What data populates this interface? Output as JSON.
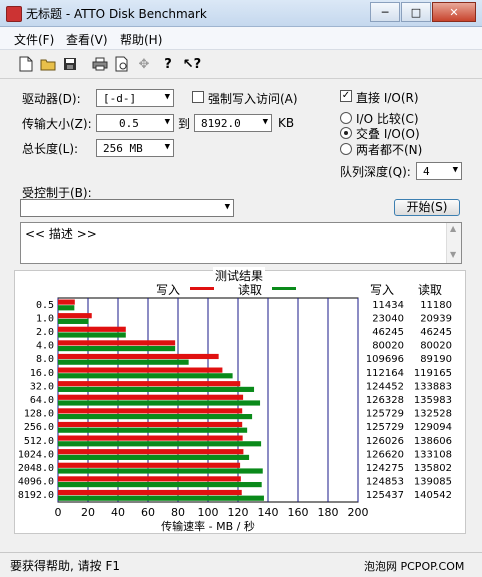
{
  "window": {
    "title": "无标题 - ATTO Disk Benchmark"
  },
  "menu": [
    "文件(F)",
    "查看(V)",
    "帮助(H)"
  ],
  "form": {
    "drive_label": "驱动器(D):",
    "drive_value": "[-d-]",
    "force_write_label": "强制写入访问(A)",
    "transfer_label": "传输大小(Z):",
    "transfer_from": "0.5",
    "to_label": "到",
    "transfer_to": "8192.0",
    "kb_label": "KB",
    "length_label": "总长度(L):",
    "length_value": "256 MB",
    "direct_io_label": "直接 I/O(R)",
    "io_compare_label": "I/O 比较(C)",
    "overlapped_label": "交叠 I/O(O)",
    "neither_label": "两者都不(N)",
    "queue_label": "队列深度(Q):",
    "queue_value": "4",
    "controlled_label": "受控制于(B):",
    "start_button": "开始(S)",
    "description": "<< 描述 >>"
  },
  "results": {
    "title": "测试结果",
    "write_legend": "写入",
    "read_legend": "读取",
    "col_write": "写入",
    "col_read": "读取",
    "write_color": "#e01010",
    "read_color": "#0a8a1a"
  },
  "chart_data": {
    "type": "bar",
    "orientation": "horizontal",
    "title": "测试结果",
    "xlabel": "传输速率 - MB / 秒",
    "xlim": [
      0,
      200
    ],
    "xticks": [
      0,
      20,
      40,
      60,
      80,
      100,
      120,
      140,
      160,
      180,
      200
    ],
    "categories": [
      "0.5",
      "1.0",
      "2.0",
      "4.0",
      "8.0",
      "16.0",
      "32.0",
      "64.0",
      "128.0",
      "256.0",
      "512.0",
      "1024.0",
      "2048.0",
      "4096.0",
      "8192.0"
    ],
    "series": [
      {
        "name": "写入",
        "color": "#e01010",
        "values": [
          11.2,
          22.5,
          45.2,
          78.1,
          107.1,
          109.6,
          121.5,
          123.4,
          122.8,
          122.8,
          123.1,
          123.6,
          121.4,
          121.9,
          122.5
        ]
      },
      {
        "name": "读取",
        "color": "#0a8a1a",
        "values": [
          10.9,
          20.4,
          45.2,
          78.1,
          87.1,
          116.4,
          130.7,
          134.7,
          129.4,
          126.1,
          135.4,
          127.4,
          136.5,
          135.8,
          137.3
        ]
      }
    ],
    "write_text": [
      "11434",
      "23040",
      "46245",
      "80020",
      "109696",
      "112164",
      "124452",
      "126328",
      "125729",
      "125729",
      "126026",
      "126620",
      "124275",
      "124853",
      "125437"
    ],
    "read_text": [
      "11180",
      "20939",
      "46245",
      "80020",
      "89190",
      "119165",
      "133883",
      "135983",
      "132528",
      "129094",
      "138606",
      "133108",
      "135802",
      "139085",
      "140542"
    ]
  },
  "status": {
    "text": "要获得帮助, 请按 F1",
    "watermark": "泡泡网 PCPOP.COM"
  }
}
